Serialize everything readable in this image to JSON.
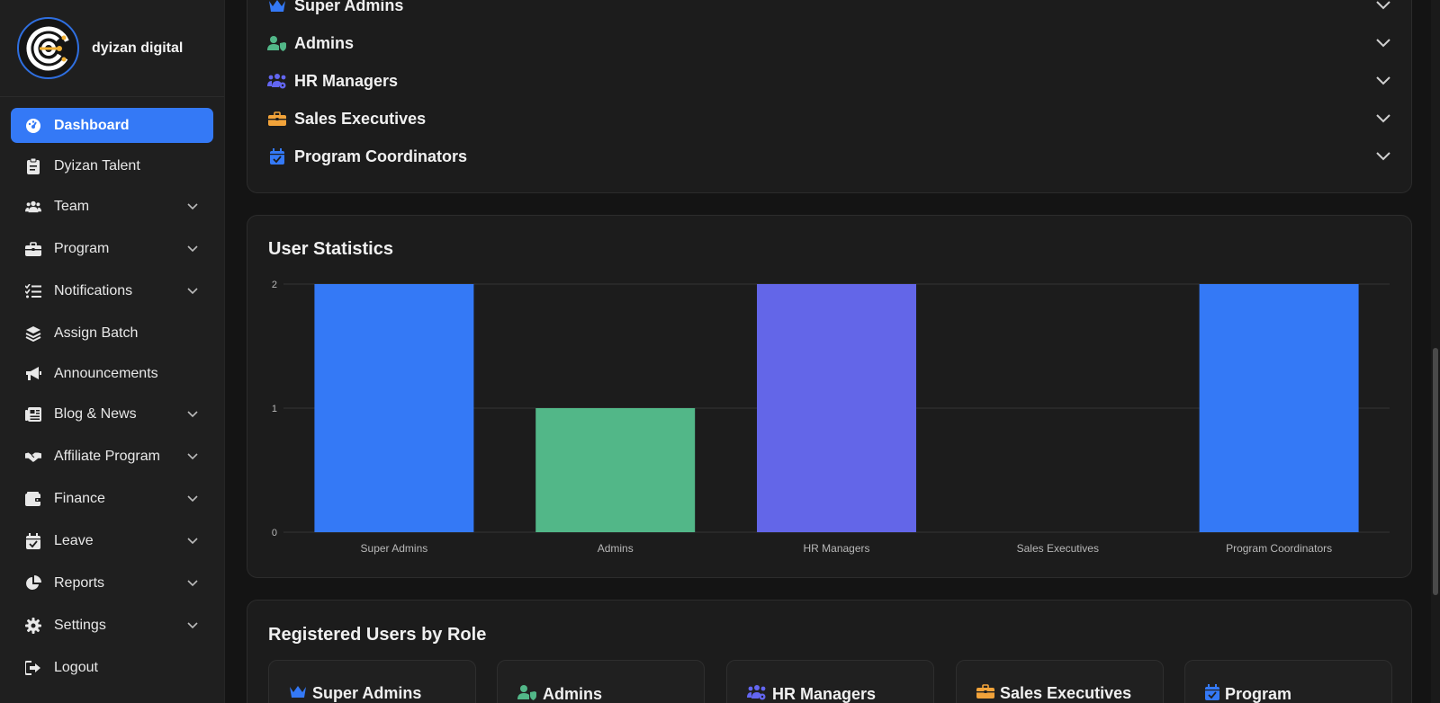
{
  "brand": {
    "name": "dyizan digital"
  },
  "sidebar": {
    "items": [
      {
        "label": "Dashboard",
        "icon": "gauge-icon",
        "active": true,
        "has_children": false
      },
      {
        "label": "Dyizan Talent",
        "icon": "clipboard-icon",
        "has_children": false
      },
      {
        "label": "Team",
        "icon": "users-icon",
        "has_children": true
      },
      {
        "label": "Program",
        "icon": "briefcase-icon",
        "has_children": true
      },
      {
        "label": "Notifications",
        "icon": "list-check-icon",
        "has_children": true
      },
      {
        "label": "Assign Batch",
        "icon": "layers-icon",
        "has_children": false
      },
      {
        "label": "Announcements",
        "icon": "megaphone-icon",
        "has_children": false
      },
      {
        "label": "Blog & News",
        "icon": "newspaper-icon",
        "has_children": true
      },
      {
        "label": "Affiliate Program",
        "icon": "handshake-icon",
        "has_children": true
      },
      {
        "label": "Finance",
        "icon": "wallet-icon",
        "has_children": true
      },
      {
        "label": "Leave",
        "icon": "calendar-check-icon",
        "has_children": true
      },
      {
        "label": "Reports",
        "icon": "pie-chart-icon",
        "has_children": true
      },
      {
        "label": "Settings",
        "icon": "gear-icon",
        "has_children": true
      },
      {
        "label": "Logout",
        "icon": "sign-out-icon",
        "has_children": false
      }
    ]
  },
  "roles_accordion": {
    "items": [
      {
        "label": "Super Admins",
        "icon": "crown-icon",
        "color": "#3479f6"
      },
      {
        "label": "Admins",
        "icon": "user-shield-icon",
        "color": "#52b788"
      },
      {
        "label": "HR Managers",
        "icon": "users-cog-icon",
        "color": "#6366f1"
      },
      {
        "label": "Sales Executives",
        "icon": "briefcase-icon",
        "color": "#f2a33a"
      },
      {
        "label": "Program Coordinators",
        "icon": "calendar-check-icon",
        "color": "#3479f6"
      }
    ]
  },
  "user_statistics": {
    "title": "User Statistics"
  },
  "chart_data": {
    "type": "bar",
    "title": "User Statistics",
    "categories": [
      "Super Admins",
      "Admins",
      "HR Managers",
      "Sales Executives",
      "Program Coordinators"
    ],
    "values": [
      2,
      1,
      2,
      0,
      2
    ],
    "colors": [
      "#3479f6",
      "#52b788",
      "#6366e8",
      "#f2a33a",
      "#3479f6"
    ],
    "ylim": [
      0,
      2
    ],
    "yticks": [
      0,
      1,
      2
    ],
    "xlabel": "",
    "ylabel": "",
    "grid": true,
    "legend": "none"
  },
  "registered_users": {
    "title": "Registered Users by Role",
    "cards": [
      {
        "label": "Super Admins",
        "icon": "crown-icon",
        "color": "#3479f6"
      },
      {
        "label": "Admins",
        "icon": "user-shield-icon",
        "color": "#52b788"
      },
      {
        "label": "HR Managers",
        "icon": "users-cog-icon",
        "color": "#6366f1"
      },
      {
        "label": "Sales Executives",
        "icon": "briefcase-icon",
        "color": "#f2a33a"
      },
      {
        "label": "Program",
        "icon": "calendar-check-icon",
        "color": "#3479f6"
      }
    ]
  }
}
